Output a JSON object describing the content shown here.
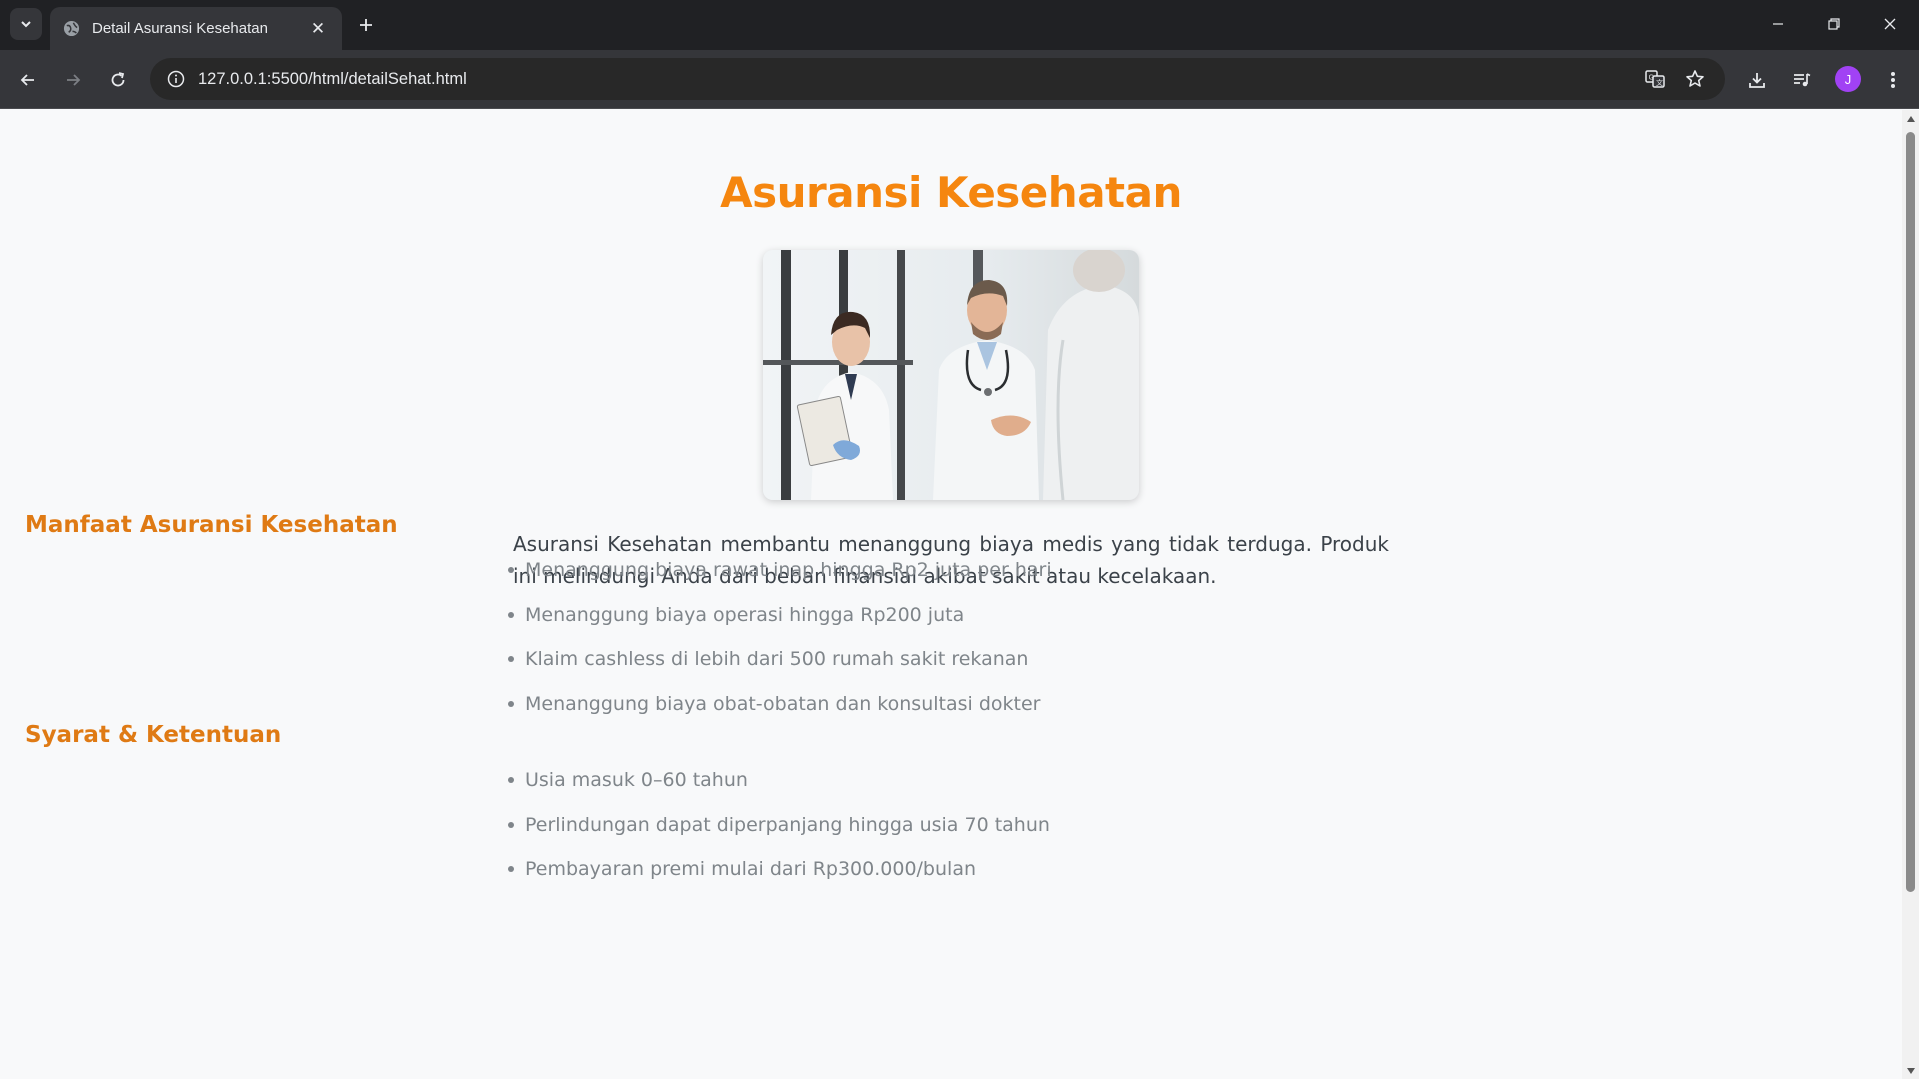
{
  "browser": {
    "tab_title": "Detail Asuransi Kesehatan",
    "url": "127.0.0.1:5500/html/detailSehat.html",
    "profile_initial": "J"
  },
  "page": {
    "title": "Asuransi Kesehatan",
    "description": "Asuransi Kesehatan membantu menanggung biaya medis yang tidak terduga. Produk ini melindungi Anda dari beban finansial akibat sakit atau kecelakaan.",
    "benefits_heading": "Manfaat Asuransi Kesehatan",
    "benefits": [
      "Menanggung biaya rawat inap hingga Rp2 juta per hari",
      "Menanggung biaya operasi hingga Rp200 juta",
      "Klaim cashless di lebih dari 500 rumah sakit rekanan",
      "Menanggung biaya obat-obatan dan konsultasi dokter"
    ],
    "terms_heading": "Syarat & Ketentuan",
    "terms": [
      "Usia masuk 0–60 tahun",
      "Perlindungan dapat diperpanjang hingga usia 70 tahun",
      "Pembayaran premi mulai dari Rp300.000/bulan"
    ]
  },
  "colors": {
    "title": "#f5860f",
    "section_heading": "#df7a14",
    "list_text": "#7f858a",
    "body_text": "#3b4249"
  }
}
